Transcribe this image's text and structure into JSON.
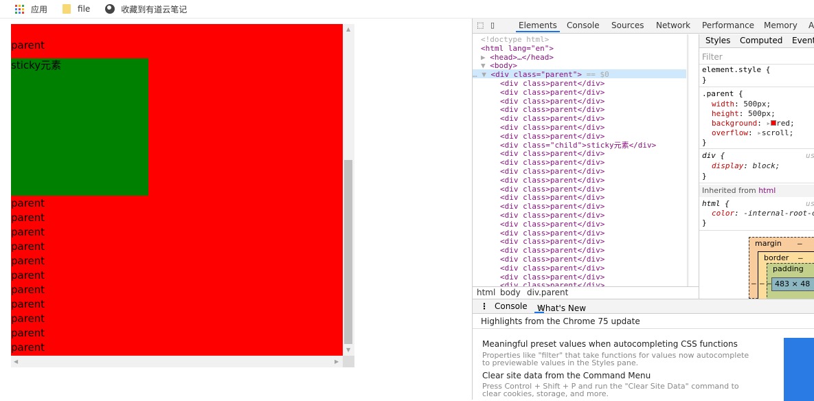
{
  "bookmarks": {
    "apps_label": "应用",
    "file_label": "file",
    "youdao_label": "收藏到有道云笔记"
  },
  "page": {
    "parent_lines_before": [
      "parent"
    ],
    "sticky_label": "sticky元素",
    "parent_lines_after": [
      "parent",
      "parent",
      "parent",
      "parent",
      "parent",
      "parent",
      "parent",
      "parent",
      "parent",
      "parent",
      "parent"
    ],
    "colors": {
      "parent_bg": "#ff0000",
      "sticky_bg": "#008000"
    }
  },
  "devtools": {
    "tabs": [
      "Elements",
      "Console",
      "Sources",
      "Network",
      "Performance",
      "Memory",
      "A"
    ],
    "active_tab": "Elements",
    "dom": {
      "doctype": "<!doctype html>",
      "html_open": "<html lang=\"en\">",
      "head": "<head>…</head>",
      "body_open": "<body>",
      "selected_open": "<div class=\"parent\">",
      "selected_suffix": " == $0",
      "row_parent": "<div class>parent</div>",
      "row_child": "<div class=\"child\">sticky元素</div>",
      "ellipsis": "…"
    },
    "breadcrumb": [
      "html",
      "body",
      "div.parent"
    ],
    "styles": {
      "tabs": [
        "Styles",
        "Computed",
        "Event"
      ],
      "filter_placeholder": "Filter",
      "element_style": "element.style {",
      "close": "}",
      "parent_rule": ".parent {",
      "props": [
        {
          "name": "width",
          "value": "500px;"
        },
        {
          "name": "height",
          "value": "500px;"
        },
        {
          "name": "background",
          "value": "red;"
        },
        {
          "name": "overflow",
          "value": "scroll;"
        }
      ],
      "div_rule": "div {",
      "div_source": "us",
      "div_prop": {
        "name": "display",
        "value": "block;"
      },
      "inherited_label": "Inherited from",
      "inherited_from": "html",
      "html_rule": "html {",
      "html_source": "us",
      "html_prop": {
        "name": "color",
        "value": "-internal-root-c"
      },
      "boxmodel": {
        "margin": "margin",
        "border": "border",
        "padding": "padding",
        "dash": "–",
        "content": "483 × 48"
      }
    },
    "drawer": {
      "tabs": [
        "Console",
        "What's New"
      ],
      "close": "×",
      "title": "Highlights from the Chrome 75 update",
      "items": [
        {
          "heading": "Meaningful preset values when autocompleting CSS functions",
          "desc": "Properties like \"filter\" that take functions for values now autocomplete to previewable values in the Styles pane."
        },
        {
          "heading": "Clear site data from the Command Menu",
          "desc": "Press Control + Shift + P and run the \"Clear Site Data\" command to clear cookies, storage, and more."
        }
      ]
    }
  }
}
